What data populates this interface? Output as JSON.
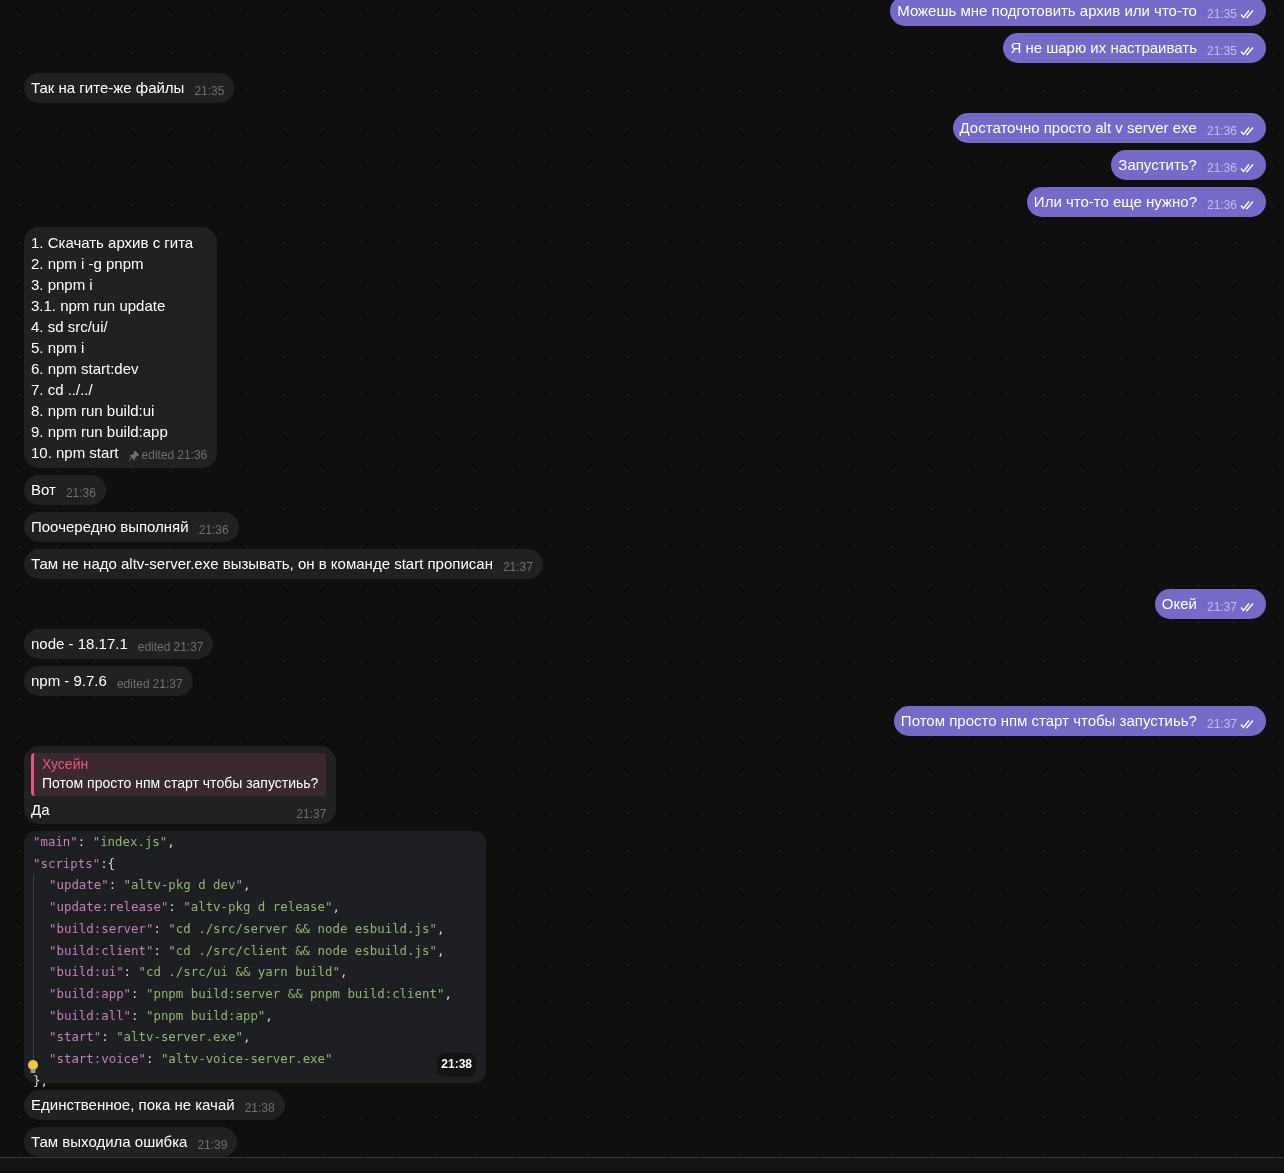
{
  "groups": [
    {
      "kind": "outgoing",
      "messages": [
        {
          "text": "Можешь мне подготовить архив или что-то",
          "time": "21:35"
        },
        {
          "text": "Я не шарю их настраивать",
          "time": "21:35"
        }
      ]
    },
    {
      "kind": "incoming",
      "messages": [
        {
          "text": "Так на гите-же файлы",
          "time": "21:35"
        }
      ]
    },
    {
      "kind": "outgoing",
      "messages": [
        {
          "text": "Достаточно просто alt v server exe",
          "time": "21:36"
        },
        {
          "text": "Запустить?",
          "time": "21:36"
        },
        {
          "text": "Или что-то еще нужно?",
          "time": "21:36"
        }
      ]
    },
    {
      "kind": "incoming",
      "messages": [
        {
          "lines": [
            "1. Скачать архив с гита",
            "2. npm i -g pnpm",
            "3. pnpm i",
            "3.1. npm run update",
            "4. sd src/ui/",
            "5. npm i",
            "6. npm start:dev",
            "7. cd ../../",
            "8. npm run build:ui",
            "9. npm run build:app",
            "10. npm start"
          ],
          "pinned": true,
          "edited": "edited",
          "time": "21:36"
        },
        {
          "text": "Вот",
          "time": "21:36"
        },
        {
          "text": "Поочередно выполняй",
          "time": "21:36"
        },
        {
          "text": "Там не надо altv-server.exe вызывать, он в команде start прописан",
          "time": "21:37"
        }
      ]
    },
    {
      "kind": "outgoing",
      "messages": [
        {
          "text": "Окей",
          "time": "21:37"
        }
      ]
    },
    {
      "kind": "incoming",
      "messages": [
        {
          "text": "node - 18.17.1",
          "edited": "edited",
          "time": "21:37"
        },
        {
          "text": "npm - 9.7.6",
          "edited": "edited",
          "time": "21:37"
        }
      ]
    },
    {
      "kind": "outgoing",
      "messages": [
        {
          "text": "Потом просто нпм старт чтобы запустиьь?",
          "time": "21:37"
        }
      ]
    },
    {
      "kind": "incoming",
      "messages": [
        {
          "reply": {
            "author": "Хусейн",
            "text": "Потом просто нпм старт чтобы запустиьь?"
          },
          "text": "Да",
          "time": "21:37"
        },
        {
          "code": [
            {
              "tokens": [
                {
                  "kind": "key",
                  "text": "\"main\""
                },
                {
                  "kind": "punct",
                  "text": ":"
                },
                {
                  "kind": "str",
                  "text": "\"index.js\""
                },
                {
                  "kind": "punct",
                  "text": ","
                }
              ]
            },
            {
              "tokens": [
                {
                  "kind": "key",
                  "text": "\"scripts\""
                },
                {
                  "kind": "punct",
                  "text": ":"
                },
                {
                  "kind": "punct",
                  "text": "{"
                }
              ],
              "children": [
                {
                  "tokens": [
                    {
                      "kind": "key",
                      "text": "\"update\""
                    },
                    {
                      "kind": "punct",
                      "text": ":"
                    },
                    {
                      "kind": "str",
                      "text": "\"altv-pkg d dev\""
                    },
                    {
                      "kind": "punct",
                      "text": ","
                    }
                  ]
                },
                {
                  "tokens": [
                    {
                      "kind": "key",
                      "text": "\"update:release\""
                    },
                    {
                      "kind": "punct",
                      "text": ":"
                    },
                    {
                      "kind": "str",
                      "text": "\"altv-pkg d release\""
                    },
                    {
                      "kind": "punct",
                      "text": ","
                    }
                  ]
                },
                {
                  "tokens": [
                    {
                      "kind": "key",
                      "text": "\"build:server\""
                    },
                    {
                      "kind": "punct",
                      "text": ":"
                    },
                    {
                      "kind": "str",
                      "text": "\"cd ./src/server && node esbuild.js\""
                    },
                    {
                      "kind": "punct",
                      "text": ","
                    }
                  ]
                },
                {
                  "tokens": [
                    {
                      "kind": "key",
                      "text": "\"build:client\""
                    },
                    {
                      "kind": "punct",
                      "text": ":"
                    },
                    {
                      "kind": "str",
                      "text": "\"cd ./src/client && node esbuild.js\""
                    },
                    {
                      "kind": "punct",
                      "text": ","
                    }
                  ]
                },
                {
                  "tokens": [
                    {
                      "kind": "key",
                      "text": "\"build:ui\""
                    },
                    {
                      "kind": "punct",
                      "text": ":"
                    },
                    {
                      "kind": "str",
                      "text": "\"cd ./src/ui && yarn build\""
                    },
                    {
                      "kind": "punct",
                      "text": ","
                    }
                  ]
                },
                {
                  "tokens": [
                    {
                      "kind": "key",
                      "text": "\"build:app\""
                    },
                    {
                      "kind": "punct",
                      "text": ":"
                    },
                    {
                      "kind": "str",
                      "text": "\"pnpm build:server && pnpm build:client\""
                    },
                    {
                      "kind": "punct",
                      "text": ","
                    }
                  ]
                },
                {
                  "tokens": [
                    {
                      "kind": "key",
                      "text": "\"build:all\""
                    },
                    {
                      "kind": "punct",
                      "text": ":"
                    },
                    {
                      "kind": "str",
                      "text": "\"pnpm build:app\""
                    },
                    {
                      "kind": "punct",
                      "text": ","
                    }
                  ]
                },
                {
                  "tokens": [
                    {
                      "kind": "key",
                      "text": "\"start\""
                    },
                    {
                      "kind": "punct",
                      "text": ":"
                    },
                    {
                      "kind": "str",
                      "text": "\"altv-server.exe\""
                    },
                    {
                      "kind": "punct",
                      "text": ","
                    }
                  ]
                },
                {
                  "tokens": [
                    {
                      "kind": "key",
                      "text": "\"start:voice\""
                    },
                    {
                      "kind": "punct",
                      "text": ":"
                    },
                    {
                      "kind": "str",
                      "text": "\"altv-voice-server.exe\""
                    }
                  ]
                }
              ]
            },
            {
              "tokens": [
                {
                  "kind": "punct",
                  "text": "},"
                }
              ]
            }
          ],
          "time": "21:38"
        },
        {
          "text": "Единственное, пока не качай",
          "time": "21:38"
        },
        {
          "text": "Там выходила ошибка",
          "time": "21:39"
        }
      ]
    }
  ]
}
